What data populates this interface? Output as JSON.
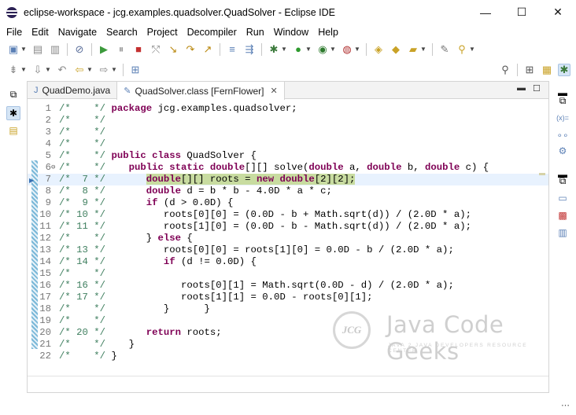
{
  "window": {
    "title": "eclipse-workspace - jcg.examples.quadsolver.QuadSolver - Eclipse IDE",
    "minimize": "—",
    "maximize": "☐",
    "close": "✕"
  },
  "menu": [
    "File",
    "Edit",
    "Navigate",
    "Search",
    "Project",
    "Decompiler",
    "Run",
    "Window",
    "Help"
  ],
  "tabs": [
    {
      "label": "QuadDemo.java",
      "icon": "java-file-icon",
      "active": false
    },
    {
      "label": "QuadSolver.class [FernFlower]",
      "icon": "class-file-icon",
      "active": true
    }
  ],
  "editor": {
    "current_line": 7,
    "lines": [
      {
        "n": "1",
        "c": "/*    */",
        "code": [
          [
            "kw",
            "package"
          ],
          [
            "t",
            " jcg.examples.quadsolver;"
          ]
        ]
      },
      {
        "n": "2",
        "c": "/*    */",
        "code": []
      },
      {
        "n": "3",
        "c": "/*    */",
        "code": []
      },
      {
        "n": "4",
        "c": "/*    */",
        "code": []
      },
      {
        "n": "5",
        "c": "/*    */",
        "code": [
          [
            "kw",
            "public class"
          ],
          [
            "t",
            " QuadSolver {"
          ]
        ]
      },
      {
        "n": "6",
        "c": "/*    */",
        "fold": "⊖",
        "code": [
          [
            "t",
            "   "
          ],
          [
            "kw",
            "public static double"
          ],
          [
            "t",
            "[][] solve("
          ],
          [
            "kw",
            "double"
          ],
          [
            "t",
            " a, "
          ],
          [
            "kw",
            "double"
          ],
          [
            "t",
            " b, "
          ],
          [
            "kw",
            "double"
          ],
          [
            "t",
            " c) {"
          ]
        ]
      },
      {
        "n": "7",
        "c": "/*  7 */",
        "code": [
          [
            "t",
            "      "
          ],
          [
            "hlkw",
            "double"
          ],
          [
            "hl",
            "[][] roots = "
          ],
          [
            "hlkw",
            "new double"
          ],
          [
            "hl",
            "[2][2];"
          ]
        ]
      },
      {
        "n": "8",
        "c": "/*  8 */",
        "code": [
          [
            "t",
            "      "
          ],
          [
            "kw",
            "double"
          ],
          [
            "t",
            " d = b * b - 4.0D * a * c;"
          ]
        ]
      },
      {
        "n": "9",
        "c": "/*  9 */",
        "code": [
          [
            "t",
            "      "
          ],
          [
            "kw",
            "if"
          ],
          [
            "t",
            " (d > 0.0D) {"
          ]
        ]
      },
      {
        "n": "10",
        "c": "/* 10 */",
        "code": [
          [
            "t",
            "         roots[0][0] = (0.0D - b + Math.sqrt(d)) / (2.0D * a);"
          ]
        ]
      },
      {
        "n": "11",
        "c": "/* 11 */",
        "code": [
          [
            "t",
            "         roots[1][0] = (0.0D - b - Math.sqrt(d)) / (2.0D * a);"
          ]
        ]
      },
      {
        "n": "12",
        "c": "/*    */",
        "code": [
          [
            "t",
            "      } "
          ],
          [
            "kw",
            "else"
          ],
          [
            "t",
            " {"
          ]
        ]
      },
      {
        "n": "13",
        "c": "/* 13 */",
        "code": [
          [
            "t",
            "         roots[0][0] = roots[1][0] = 0.0D - b / (2.0D * a);"
          ]
        ]
      },
      {
        "n": "14",
        "c": "/* 14 */",
        "code": [
          [
            "t",
            "         "
          ],
          [
            "kw",
            "if"
          ],
          [
            "t",
            " (d != 0.0D) {"
          ]
        ]
      },
      {
        "n": "15",
        "c": "/*    */",
        "code": []
      },
      {
        "n": "16",
        "c": "/* 16 */",
        "code": [
          [
            "t",
            "            roots[0][1] = Math.sqrt(0.0D - d) / (2.0D * a);"
          ]
        ]
      },
      {
        "n": "17",
        "c": "/* 17 */",
        "code": [
          [
            "t",
            "            roots[1][1] = 0.0D - roots[0][1];"
          ]
        ]
      },
      {
        "n": "18",
        "c": "/*    */",
        "code": [
          [
            "t",
            "         }      }"
          ]
        ]
      },
      {
        "n": "19",
        "c": "/*    */",
        "code": []
      },
      {
        "n": "20",
        "c": "/* 20 */",
        "code": [
          [
            "t",
            "      "
          ],
          [
            "kw",
            "return"
          ],
          [
            "t",
            " roots;"
          ]
        ]
      },
      {
        "n": "21",
        "c": "/*    */",
        "code": [
          [
            "t",
            "   }"
          ]
        ]
      },
      {
        "n": "22",
        "c": "/*    */",
        "code": [
          [
            "t",
            "}"
          ]
        ]
      }
    ]
  },
  "watermark": {
    "logo": "JCG",
    "title": "Java Code Geeks",
    "subtitle": "JAVA 2 JAVA DEVELOPERS RESOURCE CENTER"
  },
  "colors": {
    "keyword": "#7f0055",
    "comment": "#3f7f5f",
    "current_line": "#e8f2fe",
    "highlight": "#c8dca0"
  }
}
